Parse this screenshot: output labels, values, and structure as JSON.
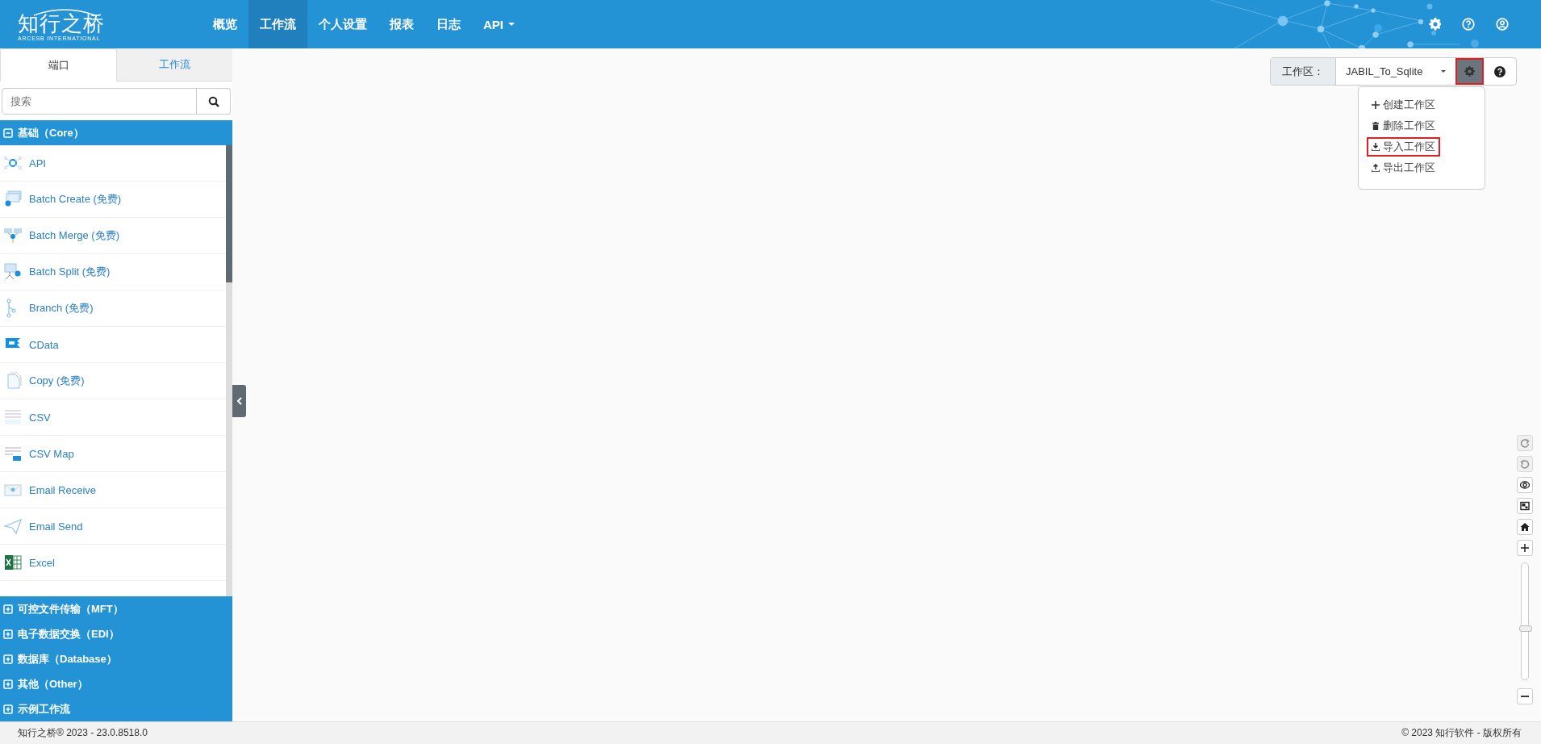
{
  "header": {
    "logo": "知行之桥",
    "logo_subtitle": "ARCESB INTERNATIONAL",
    "nav": [
      {
        "label": "概览",
        "selected": false,
        "dropdown": false
      },
      {
        "label": "工作流",
        "selected": true,
        "dropdown": false
      },
      {
        "label": "个人设置",
        "selected": false,
        "dropdown": false
      },
      {
        "label": "报表",
        "selected": false,
        "dropdown": false
      },
      {
        "label": "日志",
        "selected": false,
        "dropdown": false
      },
      {
        "label": "API",
        "selected": false,
        "dropdown": true
      }
    ]
  },
  "sidebar": {
    "tabs": [
      {
        "label": "端口",
        "selected": true
      },
      {
        "label": "工作流",
        "selected": false
      }
    ],
    "search": {
      "placeholder": "搜索"
    },
    "groups": [
      {
        "label": "基础（Core）",
        "expanded": true,
        "items": [
          "API",
          "Batch Create (免费)",
          "Batch Merge (免费)",
          "Batch Split (免费)",
          "Branch (免费)",
          "CData",
          "Copy (免费)",
          "CSV",
          "CSV Map",
          "Email Receive",
          "Email Send",
          "Excel"
        ]
      },
      {
        "label": "可控文件传输（MFT）",
        "expanded": false
      },
      {
        "label": "电子数据交换（EDI）",
        "expanded": false
      },
      {
        "label": "数据库（Database）",
        "expanded": false
      },
      {
        "label": "其他（Other）",
        "expanded": false
      },
      {
        "label": "示例工作流",
        "expanded": false
      }
    ]
  },
  "workspace": {
    "label": "工作区：",
    "value": "JABIL_To_Sqlite",
    "settings_highlighted": true,
    "menu": [
      {
        "label": "创建工作区",
        "highlighted": false
      },
      {
        "label": "删除工作区",
        "highlighted": false
      },
      {
        "label": "导入工作区",
        "highlighted": true
      },
      {
        "label": "导出工作区",
        "highlighted": false
      }
    ]
  },
  "canvas_controls": {
    "redo_disabled": true,
    "undo_disabled": true,
    "zoom": {
      "level": 0.44
    }
  },
  "footer": {
    "left": "知行之桥® 2023 - 23.0.8518.0",
    "right": "© 2023 知行软件 - 版权所有"
  }
}
